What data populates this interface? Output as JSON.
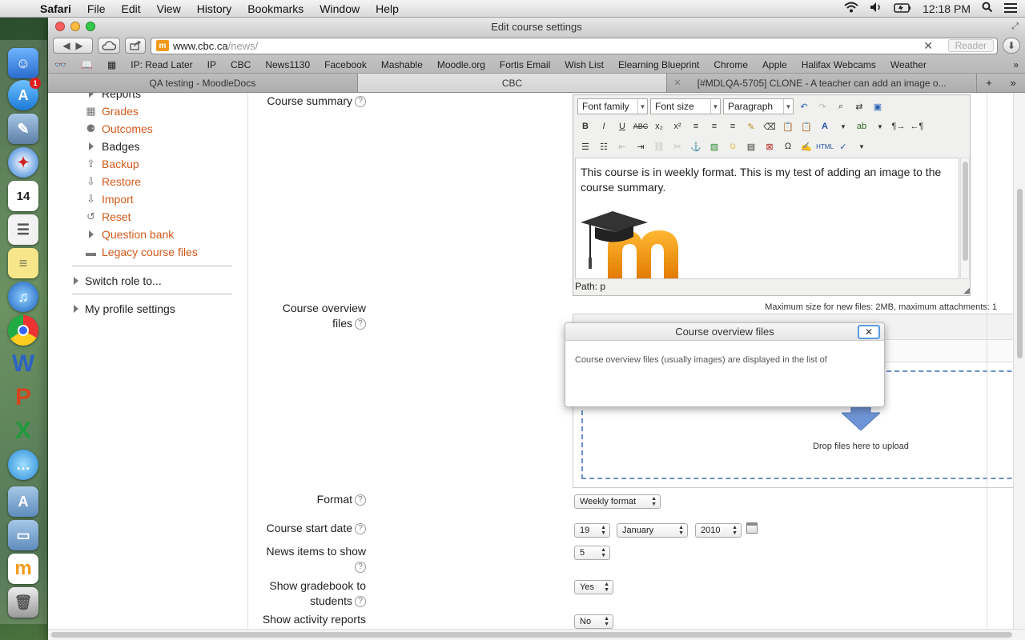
{
  "menubar": {
    "app": "Safari",
    "items": [
      "File",
      "Edit",
      "View",
      "History",
      "Bookmarks",
      "Window",
      "Help"
    ],
    "clock": "12:18 PM"
  },
  "window": {
    "title": "Edit course settings",
    "url_host": "www.cbc.ca",
    "url_path": "/news/",
    "reader": "Reader"
  },
  "bookmarks": [
    "IP: Read Later",
    "IP",
    "CBC",
    "News1130",
    "Facebook",
    "Mashable",
    "Moodle.org",
    "Fortis Email",
    "Wish List",
    "Elearning Blueprint",
    "Chrome",
    "Apple",
    "Halifax Webcams",
    "Weather"
  ],
  "tabs": [
    {
      "label": "QA testing - MoodleDocs"
    },
    {
      "label": "CBC"
    },
    {
      "label": "[#MDLQA-5705] CLONE - A teacher can add an image o..."
    }
  ],
  "sidebar": {
    "items": [
      {
        "label": "Reports",
        "icon": "triangle-icon"
      },
      {
        "label": "Grades",
        "icon": "grades-icon"
      },
      {
        "label": "Outcomes",
        "icon": "outcomes-icon"
      },
      {
        "label": "Badges",
        "icon": "triangle-icon"
      },
      {
        "label": "Backup",
        "icon": "backup-icon"
      },
      {
        "label": "Restore",
        "icon": "restore-icon"
      },
      {
        "label": "Import",
        "icon": "import-icon"
      },
      {
        "label": "Reset",
        "icon": "reset-icon"
      },
      {
        "label": "Question bank",
        "icon": "triangle-icon"
      },
      {
        "label": "Legacy course files",
        "icon": "folder-icon"
      }
    ],
    "switch_role": "Switch role to...",
    "profile": "My profile settings"
  },
  "form": {
    "course_summary_label": "Course summary",
    "editor": {
      "font_family": "Font family",
      "font_size": "Font size",
      "paragraph": "Paragraph",
      "body_text": "This course is in weekly format. This is my test of adding an image to the course summary.",
      "path": "Path: p"
    },
    "overview_label_1": "Course overview",
    "overview_label_2": "files",
    "max_size": "Maximum size for new files: 2MB, maximum attachments: 1",
    "drop_text": "Drop files here to upload",
    "format_label": "Format",
    "format_value": "Weekly format",
    "start_date_label": "Course start date",
    "start_day": "19",
    "start_month": "January",
    "start_year": "2010",
    "news_label": "News items to show",
    "news_value": "5",
    "gradebook_label_1": "Show gradebook to",
    "gradebook_label_2": "students",
    "gradebook_value": "Yes",
    "activity_label": "Show activity reports",
    "activity_value": "No"
  },
  "dialog": {
    "title": "Course overview files",
    "text": "Course overview files (usually images) are displayed in the list of"
  }
}
